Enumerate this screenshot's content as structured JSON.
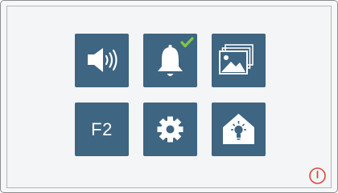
{
  "colors": {
    "tile": "#3e6582",
    "icon": "#ffffff",
    "check": "#7ec93b",
    "power": "#e0463a",
    "screen_bg": "#f3f5f6"
  },
  "menu": {
    "tiles": [
      {
        "id": "volume",
        "icon": "speaker-volume-icon"
      },
      {
        "id": "chime",
        "icon": "bell-icon",
        "badge": "checkmark-icon",
        "enabled": true
      },
      {
        "id": "gallery",
        "icon": "image-gallery-icon"
      },
      {
        "id": "function-f2",
        "label": "F2"
      },
      {
        "id": "settings",
        "icon": "gear-icon"
      },
      {
        "id": "home-light",
        "icon": "house-lightbulb-icon"
      }
    ]
  },
  "power": {
    "icon": "power-icon"
  }
}
